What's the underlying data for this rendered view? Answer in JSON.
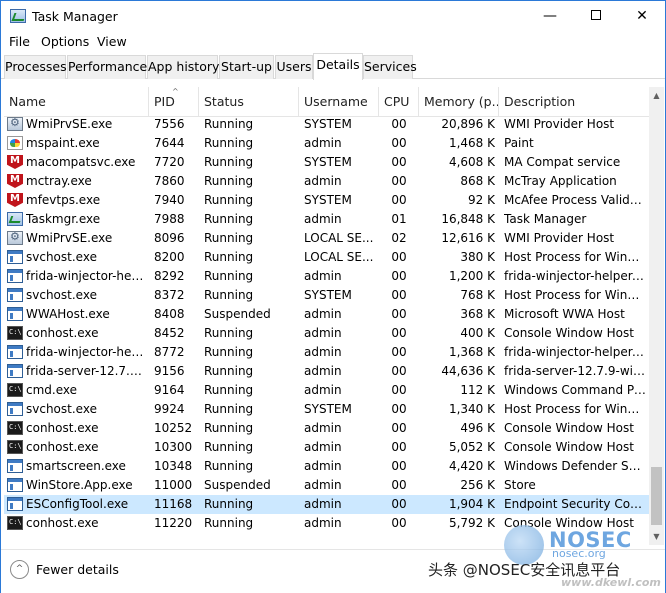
{
  "window": {
    "title": "Task Manager"
  },
  "controls": {
    "minimize": "—",
    "close": "✕"
  },
  "menu": [
    "File",
    "Options",
    "View"
  ],
  "tabs": [
    "Processes",
    "Performance",
    "App history",
    "Start-up",
    "Users",
    "Details",
    "Services"
  ],
  "active_tab": "Details",
  "columns": [
    "Name",
    "PID",
    "Status",
    "Username",
    "CPU",
    "Memory (p...",
    "Description"
  ],
  "sort_indicator": "^",
  "rows": [
    {
      "icon": "gear-icon",
      "name": "WmiPrvSE.exe",
      "pid": "7556",
      "status": "Running",
      "user": "SYSTEM",
      "cpu": "00",
      "mem": "20,896 K",
      "desc": "WMI Provider Host"
    },
    {
      "icon": "paint-icon",
      "name": "mspaint.exe",
      "pid": "7644",
      "status": "Running",
      "user": "admin",
      "cpu": "00",
      "mem": "1,468 K",
      "desc": "Paint"
    },
    {
      "icon": "mcafee-icon",
      "name": "macompatsvc.exe",
      "pid": "7720",
      "status": "Running",
      "user": "SYSTEM",
      "cpu": "00",
      "mem": "4,608 K",
      "desc": "MA Compat service"
    },
    {
      "icon": "mcafee-icon",
      "name": "mctray.exe",
      "pid": "7860",
      "status": "Running",
      "user": "admin",
      "cpu": "00",
      "mem": "868 K",
      "desc": "McTray Application"
    },
    {
      "icon": "mcafee-icon",
      "name": "mfevtps.exe",
      "pid": "7940",
      "status": "Running",
      "user": "SYSTEM",
      "cpu": "00",
      "mem": "92 K",
      "desc": "McAfee Process Validati..."
    },
    {
      "icon": "taskmgr-icon",
      "name": "Taskmgr.exe",
      "pid": "7988",
      "status": "Running",
      "user": "admin",
      "cpu": "01",
      "mem": "16,848 K",
      "desc": "Task Manager"
    },
    {
      "icon": "gear-icon",
      "name": "WmiPrvSE.exe",
      "pid": "8096",
      "status": "Running",
      "user": "LOCAL SE...",
      "cpu": "02",
      "mem": "12,616 K",
      "desc": "WMI Provider Host"
    },
    {
      "icon": "window-icon",
      "name": "svchost.exe",
      "pid": "8200",
      "status": "Running",
      "user": "LOCAL SE...",
      "cpu": "00",
      "mem": "380 K",
      "desc": "Host Process for Windo..."
    },
    {
      "icon": "window-icon",
      "name": "frida-winjector-help...",
      "pid": "8292",
      "status": "Running",
      "user": "admin",
      "cpu": "00",
      "mem": "1,200 K",
      "desc": "frida-winjector-helper-64"
    },
    {
      "icon": "window-icon",
      "name": "svchost.exe",
      "pid": "8372",
      "status": "Running",
      "user": "SYSTEM",
      "cpu": "00",
      "mem": "768 K",
      "desc": "Host Process for Windo..."
    },
    {
      "icon": "window-icon",
      "name": "WWAHost.exe",
      "pid": "8408",
      "status": "Suspended",
      "user": "admin",
      "cpu": "00",
      "mem": "368 K",
      "desc": "Microsoft WWA Host"
    },
    {
      "icon": "console-icon",
      "name": "conhost.exe",
      "pid": "8452",
      "status": "Running",
      "user": "admin",
      "cpu": "00",
      "mem": "400 K",
      "desc": "Console Window Host"
    },
    {
      "icon": "window-icon",
      "name": "frida-winjector-help...",
      "pid": "8772",
      "status": "Running",
      "user": "admin",
      "cpu": "00",
      "mem": "1,368 K",
      "desc": "frida-winjector-helper-32"
    },
    {
      "icon": "window-icon",
      "name": "frida-server-12.7.9-w...",
      "pid": "9156",
      "status": "Running",
      "user": "admin",
      "cpu": "00",
      "mem": "44,636 K",
      "desc": "frida-server-12.7.9-wind..."
    },
    {
      "icon": "console-icon",
      "name": "cmd.exe",
      "pid": "9164",
      "status": "Running",
      "user": "admin",
      "cpu": "00",
      "mem": "112 K",
      "desc": "Windows Command Pr..."
    },
    {
      "icon": "window-icon",
      "name": "svchost.exe",
      "pid": "9924",
      "status": "Running",
      "user": "SYSTEM",
      "cpu": "00",
      "mem": "1,340 K",
      "desc": "Host Process for Windo..."
    },
    {
      "icon": "console-icon",
      "name": "conhost.exe",
      "pid": "10252",
      "status": "Running",
      "user": "admin",
      "cpu": "00",
      "mem": "496 K",
      "desc": "Console Window Host"
    },
    {
      "icon": "console-icon",
      "name": "conhost.exe",
      "pid": "10300",
      "status": "Running",
      "user": "admin",
      "cpu": "00",
      "mem": "5,052 K",
      "desc": "Console Window Host"
    },
    {
      "icon": "window-icon",
      "name": "smartscreen.exe",
      "pid": "10348",
      "status": "Running",
      "user": "admin",
      "cpu": "00",
      "mem": "4,420 K",
      "desc": "Windows Defender Sma..."
    },
    {
      "icon": "window-icon",
      "name": "WinStore.App.exe",
      "pid": "11000",
      "status": "Suspended",
      "user": "admin",
      "cpu": "00",
      "mem": "256 K",
      "desc": "Store"
    },
    {
      "icon": "window-icon",
      "name": "ESConfigTool.exe",
      "pid": "11168",
      "status": "Running",
      "user": "admin",
      "cpu": "00",
      "mem": "1,904 K",
      "desc": "Endpoint Security Confi...",
      "selected": true
    },
    {
      "icon": "console-icon",
      "name": "conhost.exe",
      "pid": "11220",
      "status": "Running",
      "user": "admin",
      "cpu": "00",
      "mem": "5,792 K",
      "desc": "Console Window Host"
    }
  ],
  "footer": {
    "fewer_details": "Fewer details",
    "toggle_glyph": "^"
  },
  "watermark": {
    "caption": "头条 @NOSEC安全讯息平台",
    "brand": "NOSEC",
    "url": "nosec.org",
    "site": "www.dkewl.com"
  }
}
